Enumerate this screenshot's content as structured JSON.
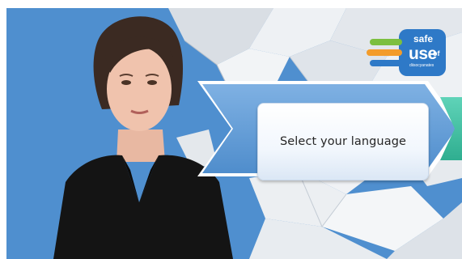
{
  "window": {
    "title": ""
  },
  "overlay": {
    "language_button_label": "Select your language"
  },
  "logo": {
    "line1": "safe",
    "line2": "use",
    "line3": "of",
    "line4": "diisocyanates"
  },
  "colors": {
    "chevron_blue": "#5b9bd5",
    "chevron_teal": "#3fc1a5",
    "logo_blue": "#2e79c7",
    "logo_green": "#7cbf3f",
    "logo_orange": "#f39c2b",
    "map_sea": "#4f8fcf",
    "map_land": "#eef1f4"
  },
  "icons": [
    "safe-use-logo",
    "map-background",
    "presenter-image"
  ]
}
